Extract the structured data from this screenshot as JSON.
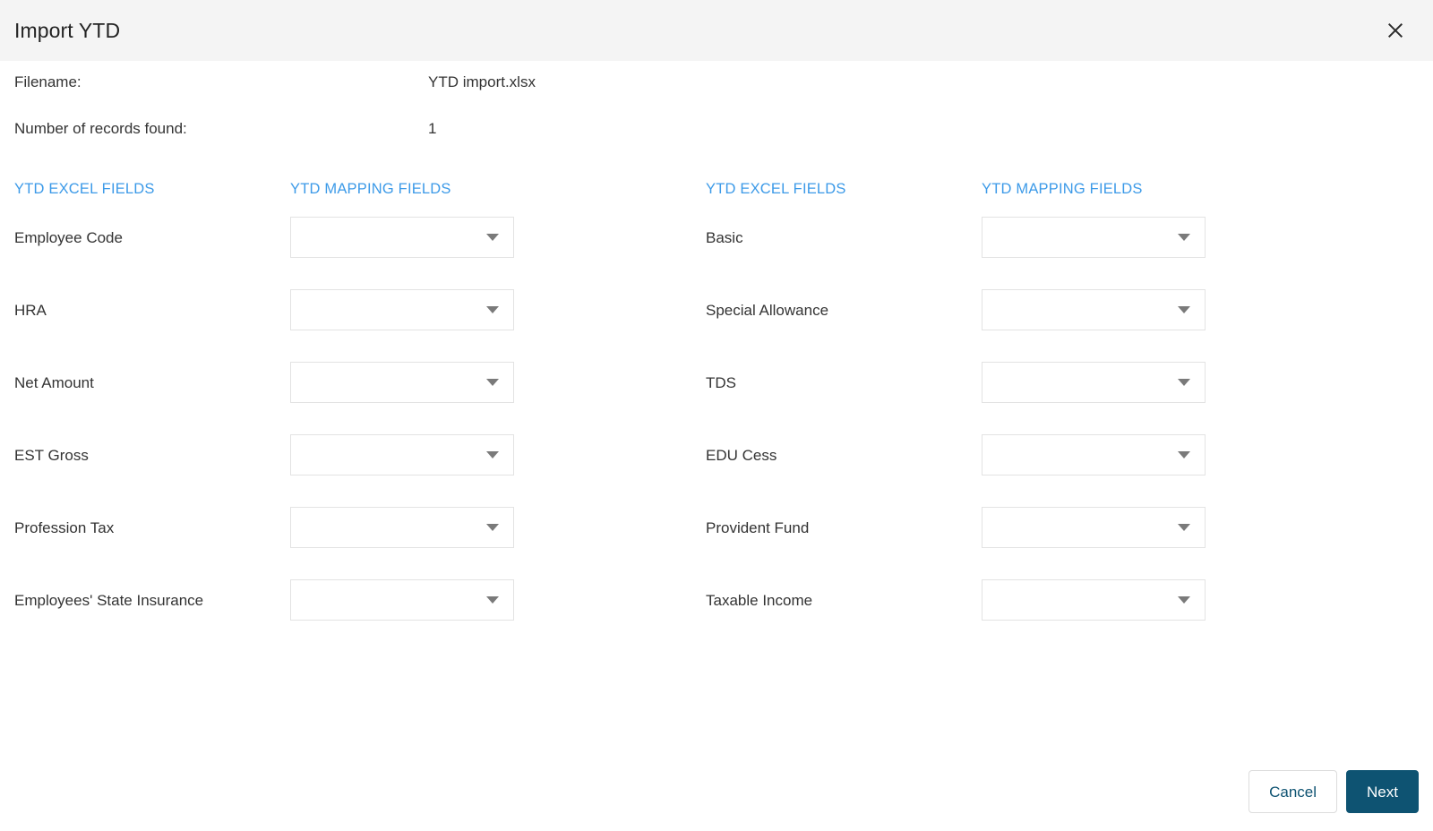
{
  "dialog": {
    "title": "Import YTD",
    "close_icon": "close-icon"
  },
  "info": {
    "filename_label": "Filename:",
    "filename_value": "YTD import.xlsx",
    "records_label": "Number of records found:",
    "records_value": "1"
  },
  "headers": {
    "excel_fields": "YTD EXCEL FIELDS",
    "mapping_fields": "YTD MAPPING FIELDS",
    "accent_color": "#3c9ae8"
  },
  "columns": {
    "left": {
      "excel_header": "YTD EXCEL FIELDS",
      "mapping_header": "YTD MAPPING FIELDS",
      "rows": [
        {
          "field": "Employee Code",
          "mapping_value": "",
          "caret_icon": "chevron-down-icon"
        },
        {
          "field": "HRA",
          "mapping_value": "",
          "caret_icon": "chevron-down-icon"
        },
        {
          "field": "Net Amount",
          "mapping_value": "",
          "caret_icon": "chevron-down-icon"
        },
        {
          "field": "EST Gross",
          "mapping_value": "",
          "caret_icon": "chevron-down-icon"
        },
        {
          "field": "Profession Tax",
          "mapping_value": "",
          "caret_icon": "chevron-down-icon"
        },
        {
          "field": "Employees' State Insurance",
          "mapping_value": "",
          "caret_icon": "chevron-down-icon"
        }
      ]
    },
    "right": {
      "excel_header": "YTD EXCEL FIELDS",
      "mapping_header": "YTD MAPPING FIELDS",
      "rows": [
        {
          "field": "Basic",
          "mapping_value": "",
          "caret_icon": "chevron-down-icon"
        },
        {
          "field": "Special Allowance",
          "mapping_value": "",
          "caret_icon": "chevron-down-icon"
        },
        {
          "field": "TDS",
          "mapping_value": "",
          "caret_icon": "chevron-down-icon"
        },
        {
          "field": "EDU Cess",
          "mapping_value": "",
          "caret_icon": "chevron-down-icon"
        },
        {
          "field": "Provident Fund",
          "mapping_value": "",
          "caret_icon": "chevron-down-icon"
        },
        {
          "field": "Taxable Income",
          "mapping_value": "",
          "caret_icon": "chevron-down-icon"
        }
      ]
    }
  },
  "footer": {
    "cancel_label": "Cancel",
    "next_label": "Next",
    "next_color": "#0e5372",
    "cancel_text_color": "#0d5271"
  }
}
